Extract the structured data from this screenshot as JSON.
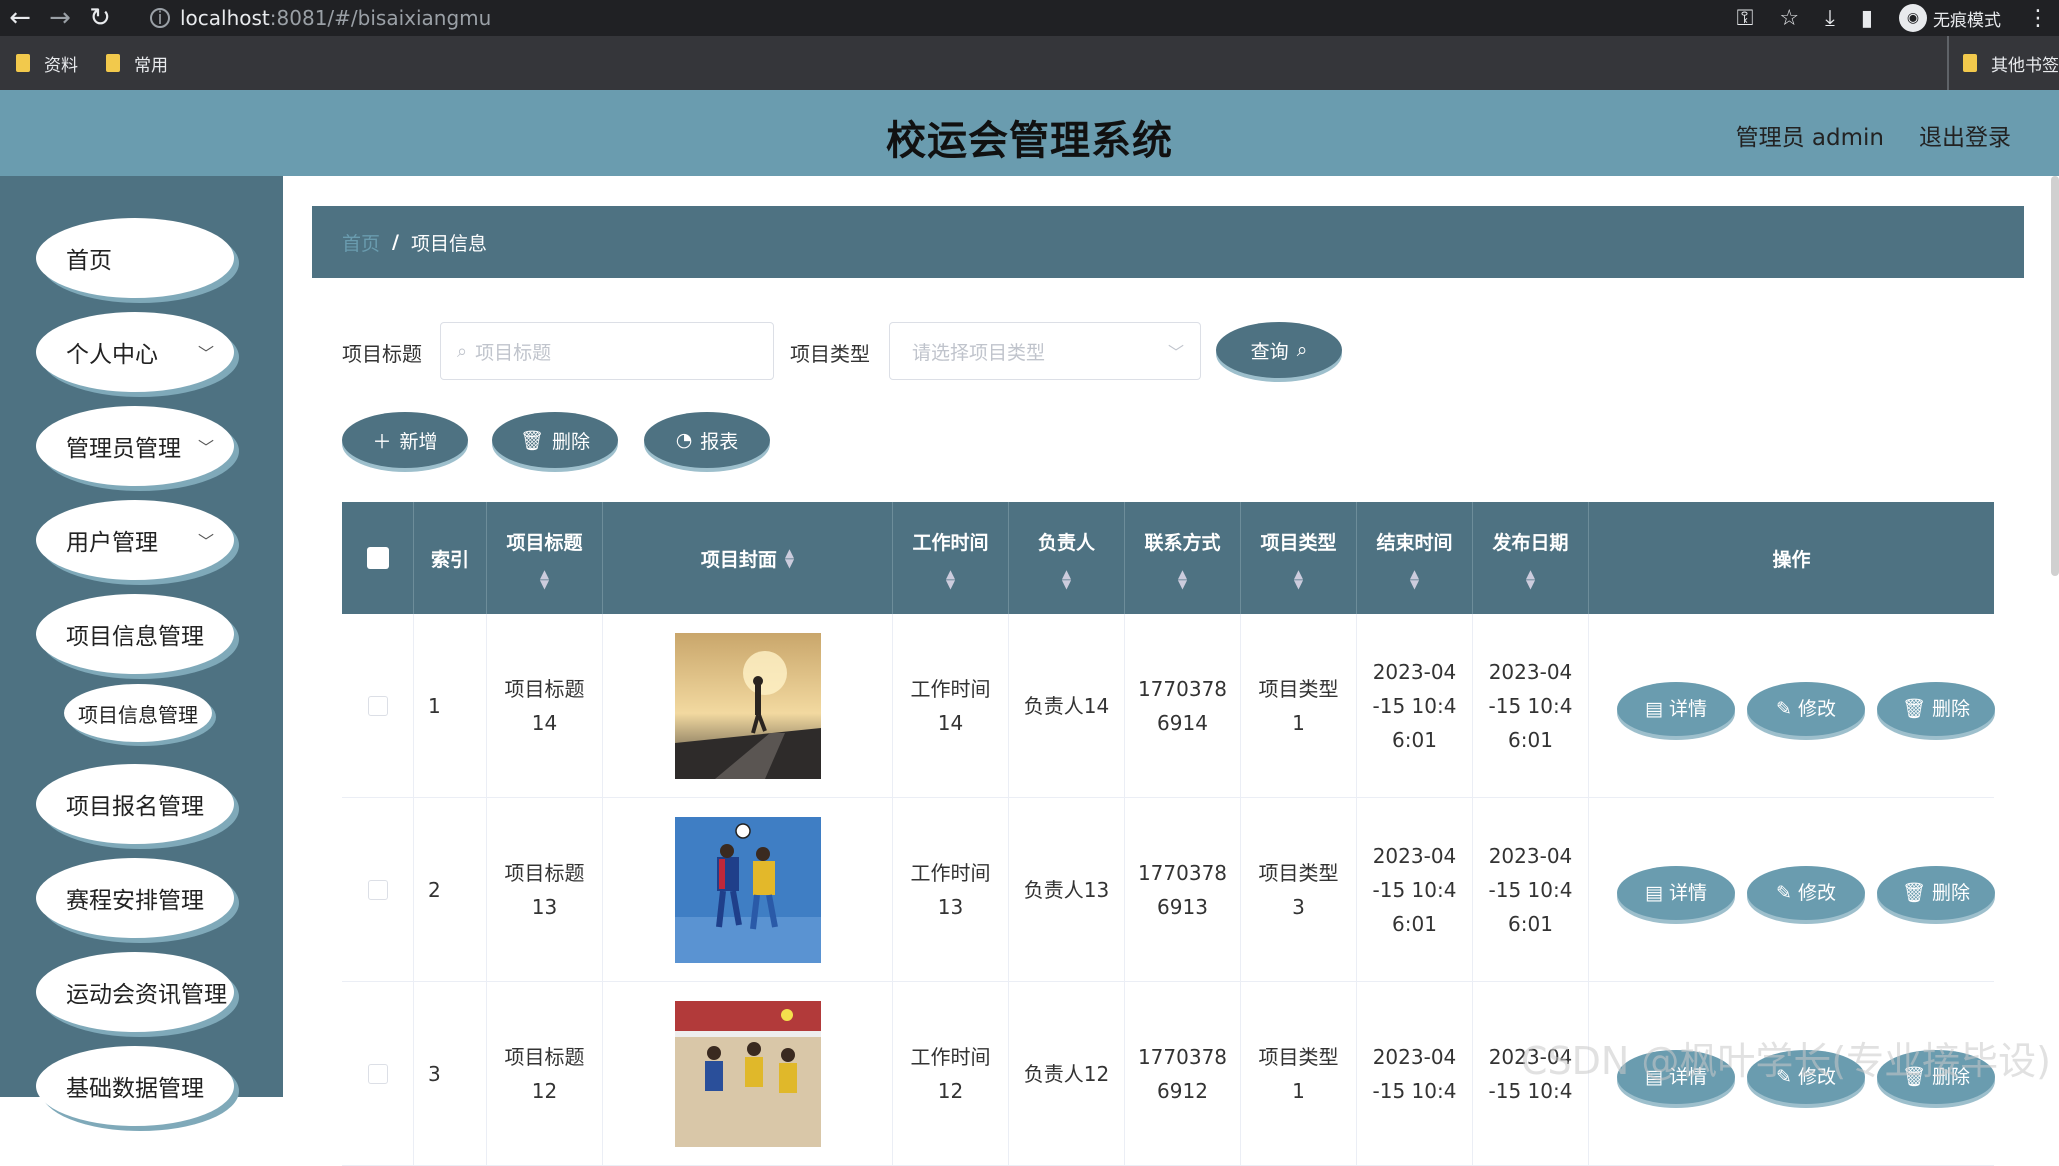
{
  "browser": {
    "url_host": "localhost",
    "url_path": ":8081/#/bisaixiangmu",
    "incognito_label": "无痕模式",
    "bookmarks": [
      "资料",
      "常用"
    ],
    "other_bookmarks": "其他书签"
  },
  "header": {
    "title": "校运会管理系统",
    "user": "管理员 admin",
    "logout": "退出登录"
  },
  "sidebar": {
    "items": [
      {
        "label": "首页"
      },
      {
        "label": "个人中心"
      },
      {
        "label": "管理员管理"
      },
      {
        "label": "用户管理"
      },
      {
        "label": "项目信息管理"
      },
      {
        "label": "项目信息管理"
      },
      {
        "label": "项目报名管理"
      },
      {
        "label": "赛程安排管理"
      },
      {
        "label": "运动会资讯管理"
      },
      {
        "label": "基础数据管理"
      }
    ]
  },
  "breadcrumb": {
    "home": "首页",
    "separator": "/",
    "current": "项目信息"
  },
  "search": {
    "title_label": "项目标题",
    "title_placeholder": "项目标题",
    "type_label": "项目类型",
    "type_placeholder": "请选择项目类型",
    "query_button": "查询"
  },
  "actions": {
    "add": "新增",
    "delete": "删除",
    "report": "报表"
  },
  "table": {
    "headers": {
      "index": "索引",
      "title": "项目标题",
      "cover": "项目封面",
      "work_time": "工作时间",
      "owner": "负责人",
      "contact": "联系方式",
      "type": "项目类型",
      "end_time": "结束时间",
      "publish_date": "发布日期",
      "ops": "操作"
    },
    "rows": [
      {
        "index": "1",
        "title_a": "项目标题",
        "title_b": "14",
        "work_a": "工作时间",
        "work_b": "14",
        "owner": "负责人14",
        "contact_a": "1770378",
        "contact_b": "6914",
        "type_a": "项目类型",
        "type_b": "1",
        "end_a": "2023-04",
        "end_b": "-15 10:4",
        "end_c": "6:01",
        "pub_a": "2023-04",
        "pub_b": "-15 10:4",
        "pub_c": "6:01"
      },
      {
        "index": "2",
        "title_a": "项目标题",
        "title_b": "13",
        "work_a": "工作时间",
        "work_b": "13",
        "owner": "负责人13",
        "contact_a": "1770378",
        "contact_b": "6913",
        "type_a": "项目类型",
        "type_b": "3",
        "end_a": "2023-04",
        "end_b": "-15 10:4",
        "end_c": "6:01",
        "pub_a": "2023-04",
        "pub_b": "-15 10:4",
        "pub_c": "6:01"
      },
      {
        "index": "3",
        "title_a": "项目标题",
        "title_b": "12",
        "work_a": "工作时间",
        "work_b": "12",
        "owner": "负责人12",
        "contact_a": "1770378",
        "contact_b": "6912",
        "type_a": "项目类型",
        "type_b": "1",
        "end_a": "2023-04",
        "end_b": "-15 10:4",
        "end_c": "",
        "pub_a": "2023-04",
        "pub_b": "-15 10:4",
        "pub_c": ""
      }
    ],
    "row_buttons": {
      "detail": "详情",
      "edit": "修改",
      "delete": "删除"
    }
  },
  "watermark": "CSDN @枫叶学长(专业接毕设)"
}
